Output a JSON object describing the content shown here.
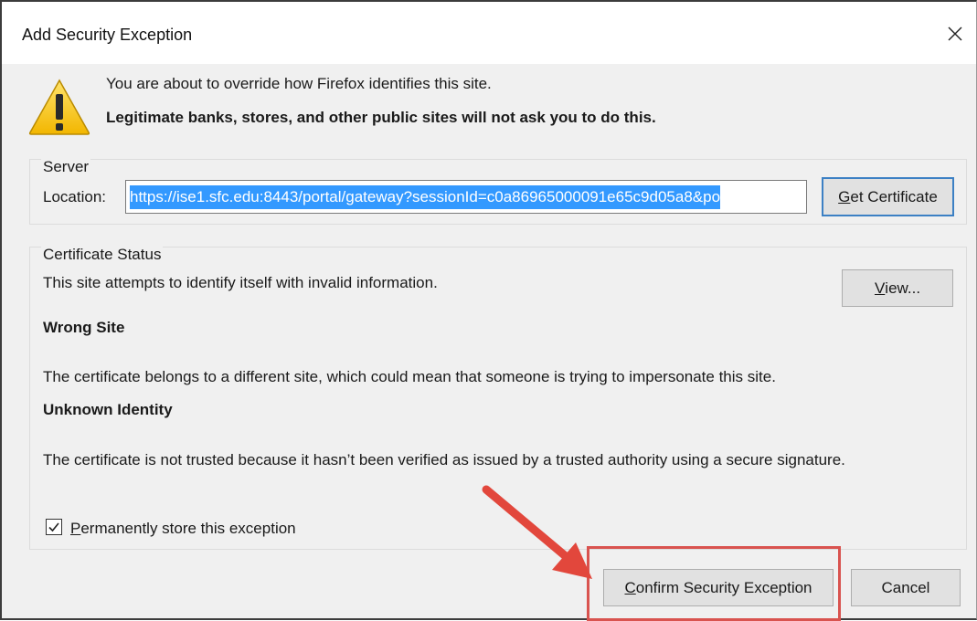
{
  "window": {
    "title": "Add Security Exception",
    "close_icon": "close-icon"
  },
  "header": {
    "warning_icon": "warning-icon",
    "message": "You are about to override how Firefox identifies this site.",
    "message_bold": "Legitimate banks, stores, and other public sites will not ask you to do this."
  },
  "server": {
    "group_label": "Server",
    "location_label": "Location:",
    "location_value": "https://ise1.sfc.edu:8443/portal/gateway?sessionId=c0a86965000091e65c9d05a8&po",
    "get_certificate_label_accel": "G",
    "get_certificate_label_rest": "et Certificate"
  },
  "certificate_status": {
    "group_label": "Certificate Status",
    "summary": "This site attempts to identify itself with invalid information.",
    "view_label_accel": "V",
    "view_label_rest": "iew...",
    "wrong_site_heading": "Wrong Site",
    "wrong_site_text": "The certificate belongs to a different site, which could mean that someone is trying to impersonate this site.",
    "unknown_identity_heading": "Unknown Identity",
    "unknown_identity_text": "The certificate is not trusted because it hasn’t been verified as issued by a trusted authority using a secure signature."
  },
  "permanent": {
    "checked": true,
    "label_accel": "P",
    "label_rest": "ermanently store this exception"
  },
  "buttons": {
    "confirm_accel": "C",
    "confirm_rest": "onfirm Security Exception",
    "cancel": "Cancel"
  },
  "annotation": {
    "highlight_color": "#d9534f",
    "arrow_color": "#e2473c"
  }
}
